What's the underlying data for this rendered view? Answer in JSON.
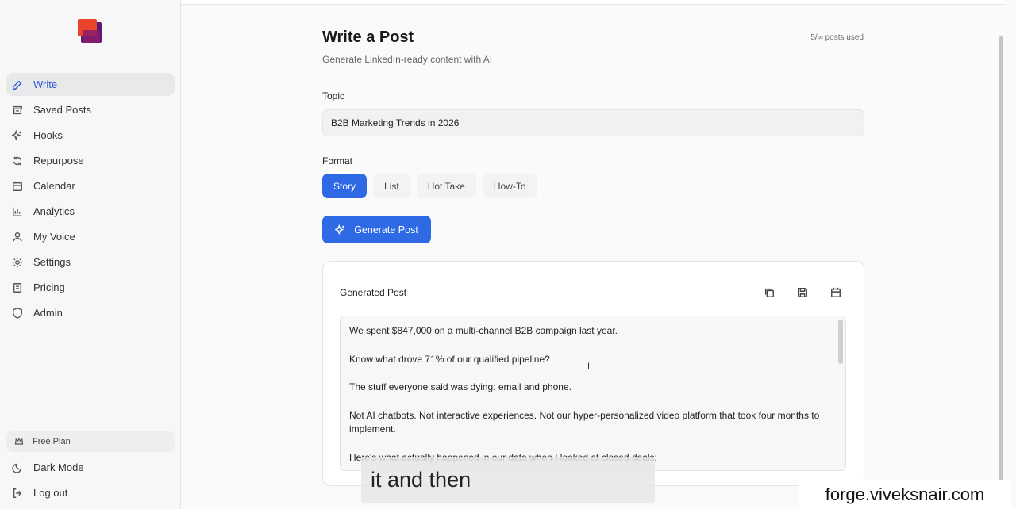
{
  "sidebar": {
    "items": [
      {
        "label": "Write",
        "icon": "pencil-icon",
        "active": true
      },
      {
        "label": "Saved Posts",
        "icon": "archive-icon"
      },
      {
        "label": "Hooks",
        "icon": "sparkle-icon"
      },
      {
        "label": "Repurpose",
        "icon": "refresh-icon"
      },
      {
        "label": "Calendar",
        "icon": "calendar-icon"
      },
      {
        "label": "Analytics",
        "icon": "bar-chart-icon"
      },
      {
        "label": "My Voice",
        "icon": "user-icon"
      },
      {
        "label": "Settings",
        "icon": "gear-icon"
      },
      {
        "label": "Pricing",
        "icon": "receipt-icon"
      },
      {
        "label": "Admin",
        "icon": "shield-icon"
      }
    ],
    "plan_label": "Free Plan",
    "bottom": [
      {
        "label": "Dark Mode",
        "icon": "moon-icon"
      },
      {
        "label": "Log out",
        "icon": "logout-icon"
      }
    ]
  },
  "header": {
    "title": "Write a Post",
    "subtitle": "Generate LinkedIn-ready content with AI",
    "usage": "5/∞ posts used"
  },
  "form": {
    "topic_label": "Topic",
    "topic_value": "B2B Marketing Trends in 2026",
    "format_label": "Format",
    "formats": [
      "Story",
      "List",
      "Hot Take",
      "How-To"
    ],
    "selected_format": "Story",
    "generate_label": "Generate Post"
  },
  "generated": {
    "title": "Generated Post",
    "paragraphs": [
      "We spent $847,000 on a multi-channel B2B campaign last year.",
      "Know what drove 71% of our qualified pipeline?",
      "The stuff everyone said was dying: email and phone.",
      "Not AI chatbots. Not interactive experiences. Not our hyper-personalized video platform that took four months to implement.",
      "Here's what actually happened in our data when I looked at closed deals:"
    ]
  },
  "overlay": {
    "caption": "it and then",
    "watermark": "forge.viveksnair.com"
  },
  "colors": {
    "accent": "#2e6ae6",
    "active_nav_text": "#2f5bd3"
  }
}
